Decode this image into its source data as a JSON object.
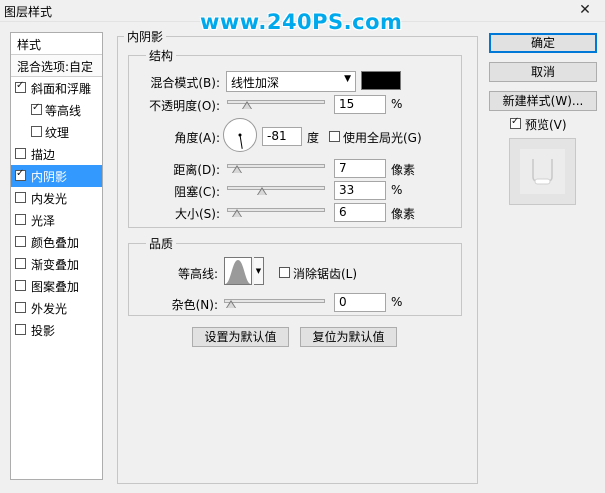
{
  "window": {
    "title": "图层样式",
    "close_glyph": "✕"
  },
  "watermark": "www.240PS.com",
  "styles_list": {
    "header": "样式",
    "blend_options": "混合选项:自定",
    "items": [
      {
        "label": "斜面和浮雕",
        "checked": true,
        "sub": false,
        "selected": false
      },
      {
        "label": "等高线",
        "checked": true,
        "sub": true,
        "selected": false
      },
      {
        "label": "纹理",
        "checked": false,
        "sub": true,
        "selected": false
      },
      {
        "label": "描边",
        "checked": false,
        "sub": false,
        "selected": false
      },
      {
        "label": "内阴影",
        "checked": true,
        "sub": false,
        "selected": true
      },
      {
        "label": "内发光",
        "checked": false,
        "sub": false,
        "selected": false
      },
      {
        "label": "光泽",
        "checked": false,
        "sub": false,
        "selected": false
      },
      {
        "label": "颜色叠加",
        "checked": false,
        "sub": false,
        "selected": false
      },
      {
        "label": "渐变叠加",
        "checked": false,
        "sub": false,
        "selected": false
      },
      {
        "label": "图案叠加",
        "checked": false,
        "sub": false,
        "selected": false
      },
      {
        "label": "外发光",
        "checked": false,
        "sub": false,
        "selected": false
      },
      {
        "label": "投影",
        "checked": false,
        "sub": false,
        "selected": false
      }
    ]
  },
  "panel": {
    "title": "内阴影",
    "structure": {
      "label": "结构",
      "blend_mode": {
        "label": "混合模式(B):",
        "value": "线性加深"
      },
      "opacity": {
        "label": "不透明度(O):",
        "value": "15",
        "unit": "%",
        "fraction": 0.15
      },
      "angle": {
        "label": "角度(A):",
        "value": "-81",
        "unit": "度",
        "degrees": -81
      },
      "global_light": {
        "label": "使用全局光(G)",
        "checked": false
      },
      "distance": {
        "label": "距离(D):",
        "value": "7",
        "unit": "像素",
        "fraction": 0.03
      },
      "choke": {
        "label": "阻塞(C):",
        "value": "33",
        "unit": "%",
        "fraction": 0.33
      },
      "size": {
        "label": "大小(S):",
        "value": "6",
        "unit": "像素",
        "fraction": 0.03
      }
    },
    "quality": {
      "label": "品质",
      "contour": {
        "label": "等高线:"
      },
      "anti_alias": {
        "label": "消除锯齿(L)",
        "checked": false
      },
      "noise": {
        "label": "杂色(N):",
        "value": "0",
        "unit": "%",
        "fraction": 0.0
      }
    },
    "make_default": "设置为默认值",
    "reset_default": "复位为默认值"
  },
  "buttons": {
    "ok": "确定",
    "cancel": "取消",
    "new_style": "新建样式(W)...",
    "preview": {
      "label": "预览(V)",
      "checked": true
    }
  },
  "colors": {
    "shadow_color": "#000000",
    "selection": "#3399ff",
    "watermark": "#00a8ec"
  }
}
